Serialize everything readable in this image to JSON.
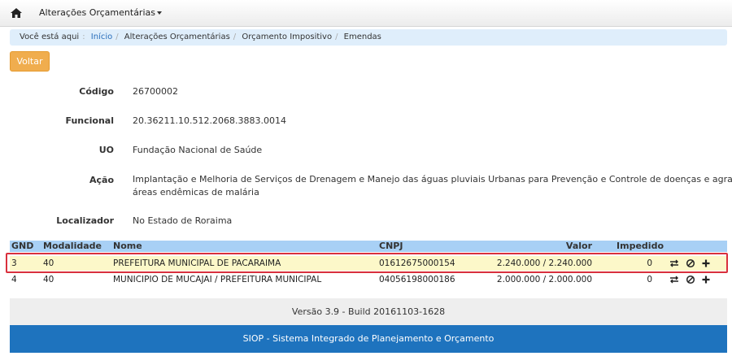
{
  "navbar": {
    "home_icon": "home-icon",
    "menu_label": "Alterações Orçamentárias"
  },
  "breadcrumb": {
    "prefix": "Você está aqui",
    "items": [
      "Início",
      "Alterações Orçamentárias",
      "Orçamento Impositivo",
      "Emendas"
    ]
  },
  "actions": {
    "back_label": "Voltar"
  },
  "details": {
    "codigo": {
      "label": "Código",
      "value": "26700002"
    },
    "funcional": {
      "label": "Funcional",
      "value": "20.36211.10.512.2068.3883.0014"
    },
    "uo": {
      "label": "UO",
      "value": "Fundação Nacional de Saúde"
    },
    "acao": {
      "label": "Ação",
      "value_line1": "Implantação e Melhoria de Serviços de Drenagem e Manejo das águas pluviais Urbanas para Prevenção e Controle de doenças e agravos em",
      "value_line2": "áreas endêmicas de malária"
    },
    "localizador": {
      "label": "Localizador",
      "value": "No Estado de Roraima"
    }
  },
  "table": {
    "headers": {
      "gnd": "GND",
      "modalidade": "Modalidade",
      "nome": "Nome",
      "cnpj": "CNPJ",
      "valor": "Valor",
      "impedido": "Impedido"
    },
    "rows": [
      {
        "gnd": "3",
        "modalidade": "40",
        "nome": "PREFEITURA MUNICIPAL DE PACARAIMA",
        "cnpj": "01612675000154",
        "valor": "2.240.000 / 2.240.000",
        "impedido": "0",
        "selected": true
      },
      {
        "gnd": "4",
        "modalidade": "40",
        "nome": "MUNICIPIO DE MUCAJAI / PREFEITURA MUNICIPAL",
        "cnpj": "04056198000186",
        "valor": "2.000.000 / 2.000.000",
        "impedido": "0",
        "selected": false
      }
    ],
    "row_actions": [
      "transfer-icon",
      "block-icon",
      "plus-icon"
    ]
  },
  "footer": {
    "version": "Versão 3.9 - Build 20161103-1628",
    "system_name": "SIOP - Sistema Integrado de Planejamento e Orçamento"
  },
  "colors": {
    "accent": "#f0ad4e",
    "header_blue": "#a8d0f5",
    "footer_blue": "#1e73be",
    "highlight": "#fcf8c9",
    "outline_red": "#d9303d"
  }
}
